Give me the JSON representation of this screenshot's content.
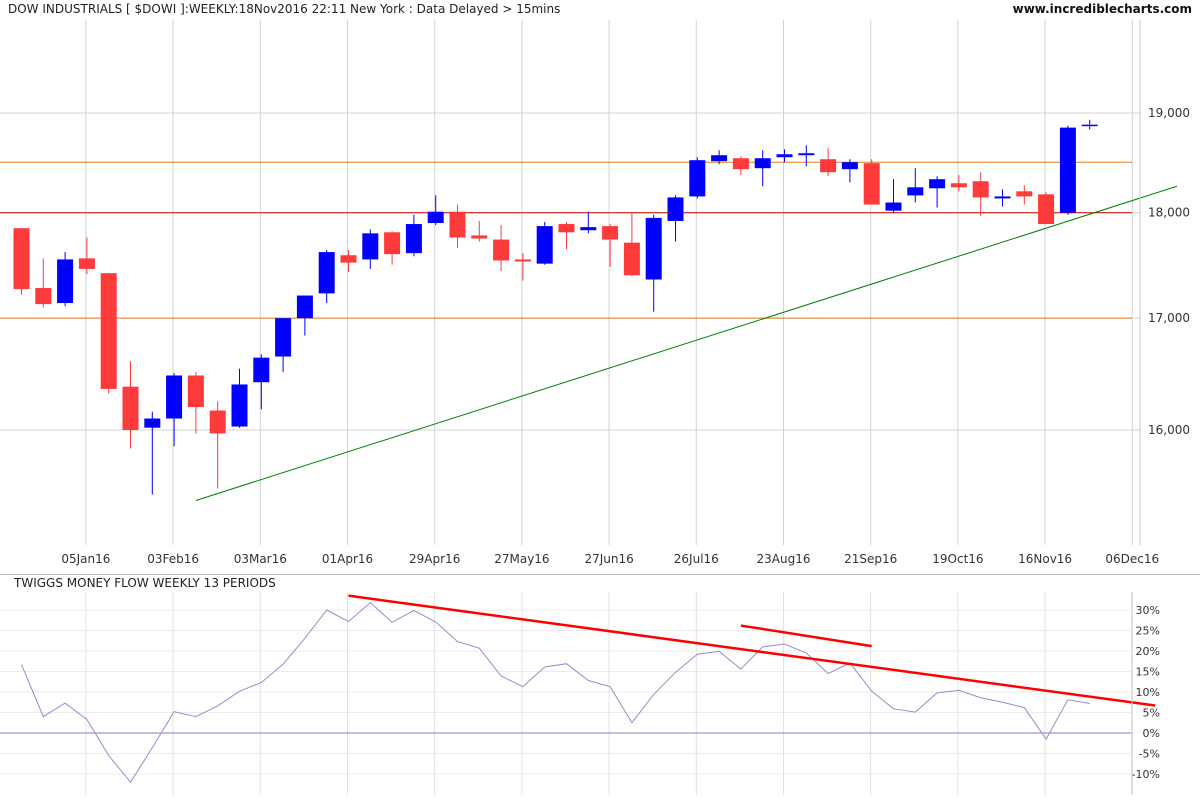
{
  "header": {
    "title": "DOW INDUSTRIALS [ $DOWI ]:WEEKLY:18Nov2016 22:11 New York : Data Delayed > 15mins",
    "website": "www.incrediblecharts.com"
  },
  "indicator": {
    "title": "TWIGGS MONEY FLOW WEEKLY 13 PERIODS"
  },
  "colors": {
    "up": "#0000ff",
    "down": "#ff3a3a",
    "grid": "#d3d3d3",
    "resistance": "#e07b20",
    "support_line": "#d00000",
    "trendline": "#008000",
    "indicator_line": "#9090cc",
    "indicator_trend": "#ff0000",
    "axis_text": "#333333"
  },
  "chart_data": [
    {
      "type": "candlestick",
      "title": "DOW INDUSTRIALS [ $DOWI ]:WEEKLY:18Nov2016 22:11 New York : Data Delayed > 15mins",
      "xlabel": "",
      "ylabel": "",
      "y_scale": "log",
      "y_ticks": [
        16000,
        17000,
        18000,
        19000
      ],
      "y_tick_labels": [
        "16,000",
        "17,000",
        "18,000",
        "19,000"
      ],
      "x_tick_labels": [
        "05Jan16",
        "03Feb16",
        "03Mar16",
        "01Apr16",
        "29Apr16",
        "27May16",
        "27Jun16",
        "26Jul16",
        "23Aug16",
        "21Sep16",
        "19Oct16",
        "16Nov16",
        "06Dec16"
      ],
      "x_tick_weeks": [
        3,
        7,
        11,
        15,
        19,
        23,
        27,
        31,
        35,
        39,
        43,
        47,
        51
      ],
      "grid": true,
      "candles": [
        {
          "week": 0,
          "open": 17850,
          "high": 17850,
          "low": 17220,
          "close": 17270
        },
        {
          "week": 1,
          "open": 17280,
          "high": 17560,
          "low": 17100,
          "close": 17130
        },
        {
          "week": 2,
          "open": 17140,
          "high": 17620,
          "low": 17110,
          "close": 17550
        },
        {
          "week": 3,
          "open": 17560,
          "high": 17760,
          "low": 17410,
          "close": 17460
        },
        {
          "week": 4,
          "open": 17420,
          "high": 17420,
          "low": 16320,
          "close": 16360
        },
        {
          "week": 5,
          "open": 16380,
          "high": 16610,
          "low": 15840,
          "close": 16000
        },
        {
          "week": 6,
          "open": 16020,
          "high": 16160,
          "low": 15450,
          "close": 16100
        },
        {
          "week": 7,
          "open": 16100,
          "high": 16500,
          "low": 15860,
          "close": 16480
        },
        {
          "week": 8,
          "open": 16480,
          "high": 16510,
          "low": 15970,
          "close": 16200
        },
        {
          "week": 9,
          "open": 16170,
          "high": 16250,
          "low": 15500,
          "close": 15970
        },
        {
          "week": 10,
          "open": 16030,
          "high": 16540,
          "low": 16020,
          "close": 16400
        },
        {
          "week": 11,
          "open": 16420,
          "high": 16670,
          "low": 16180,
          "close": 16640
        },
        {
          "week": 12,
          "open": 16650,
          "high": 16810,
          "low": 16510,
          "close": 17000
        },
        {
          "week": 13,
          "open": 17000,
          "high": 17080,
          "low": 16840,
          "close": 17210
        },
        {
          "week": 14,
          "open": 17230,
          "high": 17640,
          "low": 17140,
          "close": 17620
        },
        {
          "week": 15,
          "open": 17590,
          "high": 17640,
          "low": 17430,
          "close": 17520
        },
        {
          "week": 16,
          "open": 17550,
          "high": 17840,
          "low": 17460,
          "close": 17800
        },
        {
          "week": 17,
          "open": 17810,
          "high": 17820,
          "low": 17500,
          "close": 17600
        },
        {
          "week": 18,
          "open": 17610,
          "high": 17980,
          "low": 17580,
          "close": 17890
        },
        {
          "week": 19,
          "open": 17900,
          "high": 18170,
          "low": 17880,
          "close": 18010
        },
        {
          "week": 20,
          "open": 18010,
          "high": 18080,
          "low": 17660,
          "close": 17760
        },
        {
          "week": 21,
          "open": 17780,
          "high": 17920,
          "low": 17720,
          "close": 17750
        },
        {
          "week": 22,
          "open": 17740,
          "high": 17880,
          "low": 17440,
          "close": 17540
        },
        {
          "week": 23,
          "open": 17550,
          "high": 17610,
          "low": 17350,
          "close": 17530
        },
        {
          "week": 24,
          "open": 17510,
          "high": 17910,
          "low": 17500,
          "close": 17870
        },
        {
          "week": 25,
          "open": 17890,
          "high": 17910,
          "low": 17650,
          "close": 17810
        },
        {
          "week": 26,
          "open": 17830,
          "high": 18010,
          "low": 17800,
          "close": 17860
        },
        {
          "week": 27,
          "open": 17870,
          "high": 17890,
          "low": 17480,
          "close": 17740
        },
        {
          "week": 28,
          "open": 17710,
          "high": 18000,
          "low": 17390,
          "close": 17400
        },
        {
          "week": 29,
          "open": 17360,
          "high": 17980,
          "low": 17060,
          "close": 17950
        },
        {
          "week": 30,
          "open": 17920,
          "high": 18170,
          "low": 17720,
          "close": 18150
        },
        {
          "week": 31,
          "open": 18160,
          "high": 18550,
          "low": 18140,
          "close": 18520
        },
        {
          "week": 32,
          "open": 18510,
          "high": 18620,
          "low": 18480,
          "close": 18570
        },
        {
          "week": 33,
          "open": 18540,
          "high": 18560,
          "low": 18370,
          "close": 18430
        },
        {
          "week": 34,
          "open": 18440,
          "high": 18620,
          "low": 18260,
          "close": 18540
        },
        {
          "week": 35,
          "open": 18550,
          "high": 18630,
          "low": 18500,
          "close": 18580
        },
        {
          "week": 36,
          "open": 18570,
          "high": 18670,
          "low": 18460,
          "close": 18590
        },
        {
          "week": 37,
          "open": 18530,
          "high": 18640,
          "low": 18360,
          "close": 18400
        },
        {
          "week": 38,
          "open": 18430,
          "high": 18530,
          "low": 18300,
          "close": 18500
        },
        {
          "week": 39,
          "open": 18490,
          "high": 18530,
          "low": 18080,
          "close": 18080
        },
        {
          "week": 40,
          "open": 18020,
          "high": 18330,
          "low": 18000,
          "close": 18100
        },
        {
          "week": 41,
          "open": 18170,
          "high": 18440,
          "low": 18100,
          "close": 18250
        },
        {
          "week": 42,
          "open": 18240,
          "high": 18360,
          "low": 18050,
          "close": 18330
        },
        {
          "week": 43,
          "open": 18290,
          "high": 18370,
          "low": 18210,
          "close": 18250
        },
        {
          "week": 44,
          "open": 18310,
          "high": 18400,
          "low": 17970,
          "close": 18150
        },
        {
          "week": 45,
          "open": 18140,
          "high": 18230,
          "low": 18060,
          "close": 18160
        },
        {
          "week": 46,
          "open": 18210,
          "high": 18270,
          "low": 18080,
          "close": 18160
        },
        {
          "week": 47,
          "open": 18180,
          "high": 18200,
          "low": 17890,
          "close": 17890
        },
        {
          "week": 48,
          "open": 18000,
          "high": 18870,
          "low": 17980,
          "close": 18850
        },
        {
          "week": 49,
          "open": 18880,
          "high": 18930,
          "low": 18830,
          "close": 18880
        }
      ],
      "horizontal_lines": [
        {
          "value": 18500,
          "color": "#e07b20"
        },
        {
          "value": 18000,
          "color": "#d00000"
        },
        {
          "value": 17000,
          "color": "#e07b20"
        }
      ],
      "trendline": {
        "x1": 8,
        "y1": 15400,
        "x2": 53,
        "y2": 18260
      }
    },
    {
      "type": "line",
      "title": "TWIGGS MONEY FLOW WEEKLY 13 PERIODS",
      "y_ticks": [
        -10,
        -5,
        0,
        5,
        10,
        15,
        20,
        25,
        30
      ],
      "y_tick_labels": [
        "-10%",
        "-5%",
        "0%",
        "5%",
        "10%",
        "15%",
        "20%",
        "25%",
        "30%"
      ],
      "ylim": [
        -13,
        34
      ],
      "zero_line": true,
      "series": [
        {
          "values": [
            16.7,
            4.0,
            7.3,
            3.3,
            -5.5,
            -12.0,
            -3.6,
            5.2,
            4.0,
            6.6,
            10.2,
            12.3,
            16.8,
            23.1,
            30.0,
            27.2,
            31.8,
            27.0,
            29.9,
            27.1,
            22.3,
            20.7,
            13.9,
            11.3,
            16.1,
            16.9,
            12.8,
            11.3,
            2.5,
            9.4,
            14.8,
            19.2,
            19.9,
            15.6,
            21.0,
            21.7,
            19.5,
            14.5,
            17.1,
            10.2,
            5.9,
            5.1,
            9.8,
            10.4,
            8.6,
            7.5,
            6.2,
            -1.5,
            8.1,
            7.2
          ]
        }
      ],
      "trendlines": [
        {
          "x1": 15,
          "y1": 33.5,
          "x2": 52,
          "y2": 6.7
        },
        {
          "x1": 33,
          "y1": 26.2,
          "x2": 39,
          "y2": 21.2
        }
      ]
    }
  ]
}
